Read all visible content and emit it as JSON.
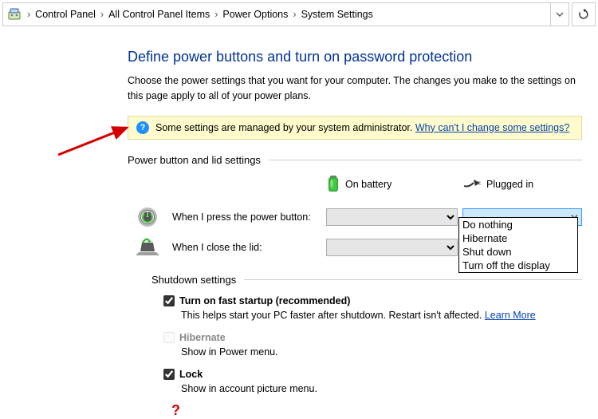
{
  "breadcrumb": {
    "items": [
      "Control Panel",
      "All Control Panel Items",
      "Power Options",
      "System Settings"
    ]
  },
  "page": {
    "title": "Define power buttons and turn on password protection",
    "description": "Choose the power settings that you want for your computer. The changes you make to the settings on this page apply to all of your power plans."
  },
  "banner": {
    "text": "Some settings are managed by your system administrator.",
    "link": "Why can't I change some settings?"
  },
  "section1": {
    "header": "Power button and lid settings",
    "col_battery": "On battery",
    "col_plugged": "Plugged in",
    "row_power_label": "When I press the power button:",
    "row_lid_label": "When I close the lid:",
    "dropdown_options": [
      "Do nothing",
      "Hibernate",
      "Shut down",
      "Turn off the display"
    ]
  },
  "section2": {
    "header": "Shutdown settings",
    "items": [
      {
        "title": "Turn on fast startup (recommended)",
        "subtext": "This helps start your PC faster after shutdown. Restart isn't affected. ",
        "link": "Learn More",
        "checked": true,
        "enabled": true
      },
      {
        "title": "Hibernate",
        "subtext": "Show in Power menu.",
        "link": null,
        "checked": false,
        "enabled": false
      },
      {
        "title": "Lock",
        "subtext": "Show in account picture menu.",
        "link": null,
        "checked": true,
        "enabled": true
      }
    ]
  },
  "annotation": {
    "question": "?"
  }
}
